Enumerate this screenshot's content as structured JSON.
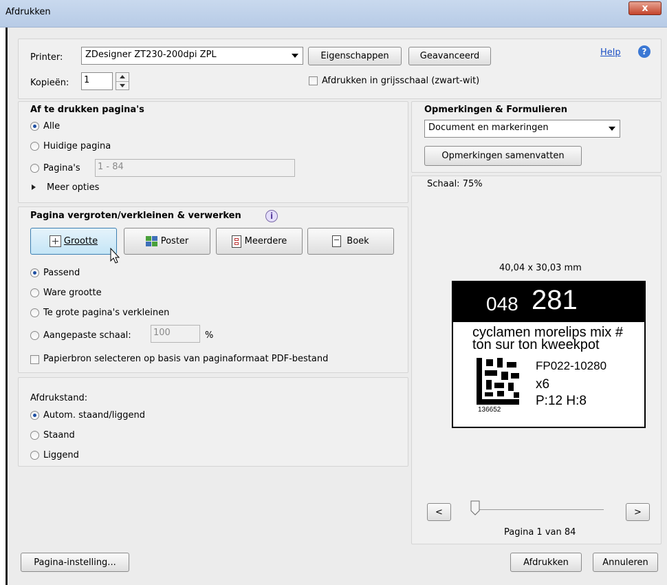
{
  "window": {
    "title": "Afdrukken",
    "close_glyph": "x"
  },
  "header": {
    "printer_label": "Printer:",
    "printer_value": "ZDesigner ZT230-200dpi ZPL",
    "properties_btn": "Eigenschappen",
    "advanced_btn": "Geavanceerd",
    "help_link": "Help",
    "copies_label": "Kopieën:",
    "copies_value": "1",
    "grayscale_label": "Afdrukken in grijsschaal (zwart-wit)"
  },
  "pages": {
    "title": "Af te drukken pagina's",
    "all": "Alle",
    "current": "Huidige pagina",
    "pages": "Pagina's",
    "pages_range": "1 - 84",
    "more": "Meer opties"
  },
  "scaling": {
    "title": "Pagina vergroten/verkleinen & verwerken",
    "tabs": [
      "Grootte",
      "Poster",
      "Meerdere",
      "Boek"
    ],
    "fit": "Passend",
    "actual": "Ware grootte",
    "shrink": "Te grote pagina's verkleinen",
    "custom": "Aangepaste schaal:",
    "custom_value": "100",
    "percent": "%",
    "paper_source": "Papierbron selecteren op basis van paginaformaat PDF-bestand"
  },
  "orientation": {
    "title": "Afdrukstand:",
    "auto": "Autom. staand/liggend",
    "portrait": "Staand",
    "landscape": "Liggend"
  },
  "comments": {
    "title": "Opmerkingen & Formulieren",
    "select_value": "Document en markeringen",
    "summarize_btn": "Opmerkingen samenvatten"
  },
  "preview": {
    "scale": "Schaal: 75%",
    "dimensions": "40,04 x 30,03 mm",
    "label_num_small": "048",
    "label_num_big": "281",
    "line1": "cyclamen morelips mix #",
    "line2": "ton sur ton kweekpot",
    "code": "FP022-10280",
    "qty": "x6",
    "ph": "P:12 H:8",
    "barcode_num": "136652",
    "prev": "<",
    "next": ">",
    "page_status": "Pagina 1 van 84"
  },
  "footer": {
    "page_setup": "Pagina-instelling...",
    "print": "Afdrukken",
    "cancel": "Annuleren"
  }
}
